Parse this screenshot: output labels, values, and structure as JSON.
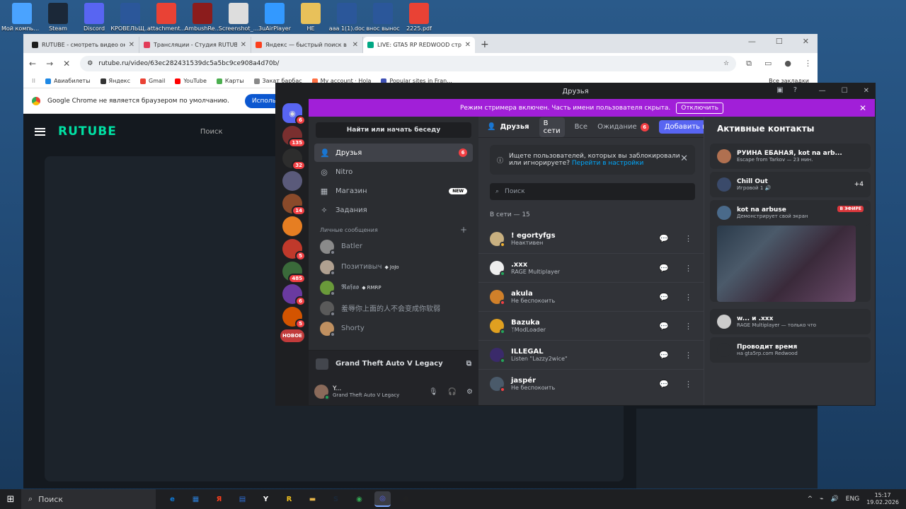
{
  "desktop": {
    "icons": [
      {
        "label": "Мой компьютер",
        "color": "#4aa3ff"
      },
      {
        "label": "Steam",
        "color": "#1b2838"
      },
      {
        "label": "Discord",
        "color": "#5865f2"
      },
      {
        "label": "КРОВЕЛЬЩ...",
        "color": "#2b579a"
      },
      {
        "label": "attachment...",
        "color": "#e94235"
      },
      {
        "label": "AmbushRe...",
        "color": "#8b1c1c"
      },
      {
        "label": "Screenshot_...",
        "color": "#dddddd"
      },
      {
        "label": "3uAirPlayer",
        "color": "#3399ff"
      },
      {
        "label": "НЕ",
        "color": "#e8c15a"
      },
      {
        "label": "ааа 1(1).doc",
        "color": "#2b579a"
      },
      {
        "label": "внос вынос",
        "color": "#2b579a"
      },
      {
        "label": "2225.pdf",
        "color": "#e94235"
      }
    ]
  },
  "chrome": {
    "tabs": [
      {
        "title": "RUTUBE - смотреть видео онлайн",
        "color": "#1d1d1d"
      },
      {
        "title": "Трансляции - Студия RUTUBE",
        "color": "#e23c58"
      },
      {
        "title": "Яндекс — быстрый поиск в интернете",
        "color": "#fc3f1d"
      },
      {
        "title": "LIVE: GTA5 RP REDWOOD стрим",
        "color": "#00a884"
      }
    ],
    "url": "rutube.ru/video/63ec282431539dc5a5bc9ce908a4d70b/",
    "bookmarks": [
      {
        "label": "Авиабилеты",
        "color": "#1e88e5"
      },
      {
        "label": "Яндекс",
        "color": "#333333"
      },
      {
        "label": "Gmail",
        "color": "#ea4335"
      },
      {
        "label": "YouTube",
        "color": "#ff0000"
      },
      {
        "label": "Карты",
        "color": "#4caf50"
      },
      {
        "label": "Закат барбас",
        "color": "#888888"
      },
      {
        "label": "My account · Hola",
        "color": "#ff7043"
      },
      {
        "label": "Popular sites in Fran...",
        "color": "#3f51b5"
      }
    ],
    "bookmarks_right": "Все закладки",
    "infobar_text": "Google Chrome не является браузером по умолчанию.",
    "infobar_button": "Использовать по ум",
    "rutube_logo": "RUTUBE",
    "rutube_search": "Поиск"
  },
  "discord": {
    "window_title": "Друзья",
    "streamer_bar_text": "Режим стримера включен. Часть имени пользователя скрыта.",
    "streamer_bar_button": "Отключить",
    "servers": [
      {
        "badge": "6",
        "color": "#5865f2",
        "home": true
      },
      {
        "badge": "135",
        "color": "#7a2f2f"
      },
      {
        "badge": "32",
        "color": "#2d2d2d"
      },
      {
        "badge": "",
        "color": "#5a5a7a"
      },
      {
        "badge": "14",
        "color": "#8a4a2a"
      },
      {
        "badge": "",
        "color": "#e67e22"
      },
      {
        "badge": "5",
        "color": "#c0392b"
      },
      {
        "badge": "485",
        "color": "#3a6a3a"
      },
      {
        "badge": "6",
        "color": "#6a3aa0"
      },
      {
        "badge": "5",
        "color": "#d35400"
      }
    ],
    "new_badge": "НОВОЕ",
    "dm_search": "Найти или начать беседу",
    "nav": [
      {
        "label": "Друзья",
        "icon": "👤",
        "count": "6",
        "new": ""
      },
      {
        "label": "Nitro",
        "icon": "◎",
        "count": "",
        "new": ""
      },
      {
        "label": "Магазин",
        "icon": "▦",
        "count": "",
        "new": "NEW"
      },
      {
        "label": "Задания",
        "icon": "✧",
        "count": "",
        "new": ""
      }
    ],
    "dm_header": "Личные сообщения",
    "dms": [
      {
        "name": "Batler",
        "tag": "",
        "color": "#8a8a8a",
        "status": "#80848e"
      },
      {
        "name": "Позитивыч",
        "tag": "JoJo",
        "color": "#b0a090",
        "status": "#80848e"
      },
      {
        "name": "𝕽𝖆𝖋𝖆𝖔",
        "tag": "RMRP",
        "color": "#6a9a3a",
        "status": "#80848e"
      },
      {
        "name": "羞辱你上面的人不会变成你软弱",
        "tag": "",
        "color": "#5a5a5a",
        "status": "#80848e"
      },
      {
        "name": "Shorty",
        "tag": "",
        "color": "#c09060",
        "status": "#80848e"
      }
    ],
    "activity_game": "Grand Theft Auto V Legacy",
    "user": {
      "name": "Y...",
      "status": "Grand Theft Auto V Legacy"
    },
    "friends_header": {
      "title": "Друзья",
      "tabs": [
        "В сети",
        "Все"
      ],
      "pending_label": "Ожидание",
      "pending_count": "6",
      "add_label": "Добавить в друзья"
    },
    "notice_text": "Ищете пользователей, которых вы заблокировали или игнорируете?",
    "notice_link": "Перейти в настройки",
    "search_placeholder": "Поиск",
    "online_label": "В сети — 15",
    "friends": [
      {
        "name": "! egortyfgs",
        "status": "Неактивен",
        "color": "#c8b080",
        "dot": "#f0b232"
      },
      {
        "name": ".xxx",
        "status": "RAGE Multiplayer",
        "color": "#eeeeee",
        "dot": "#23a55a"
      },
      {
        "name": "akula",
        "status": "Не беспокоить",
        "color": "#d0802a",
        "dot": "#f23f43"
      },
      {
        "name": "Bazuka",
        "status": "ᛉModLoader",
        "color": "#e0a020",
        "dot": "#23a55a"
      },
      {
        "name": "ILLEGAL",
        "status": "Listen \"Lazzy2wice\"",
        "color": "#3a2a6a",
        "dot": "#23a55a"
      },
      {
        "name": "jaspér",
        "status": "Не беспокоить",
        "color": "#4a5a6a",
        "dot": "#f23f43"
      }
    ],
    "active_title": "Активные контакты",
    "active": [
      {
        "name": "РУИНА ЕБАНАЯ, kot na arb...",
        "sub": "Escape from Tarkov — 23 мин.",
        "color": "#b07050",
        "extra": ""
      },
      {
        "name": "Chill Out",
        "sub": "Игровой 1 🔊",
        "color": "#3a4a6a",
        "extra": "+4"
      },
      {
        "name": "kot na arbuse",
        "sub": "Демонстрирует свой экран",
        "color": "#4a6a8a",
        "live": "В ЭФИРЕ"
      },
      {
        "name": "w... и .xxx",
        "sub": "RAGE Multiplayer — только что",
        "color": "#cccccc",
        "extra": ""
      },
      {
        "name": "Проводит время",
        "sub": "на gta5rp.com Redwood",
        "color": "#2b2d31",
        "extra": ""
      }
    ]
  },
  "taskbar": {
    "search": "Поиск",
    "apps": [
      {
        "label": "e",
        "color": "#0f7bd8"
      },
      {
        "label": "▦",
        "color": "#2b7cd3"
      },
      {
        "label": "Я",
        "color": "#fc3f1d"
      },
      {
        "label": "▤",
        "color": "#2f6fd6"
      },
      {
        "label": "Y",
        "color": "#ffffff"
      },
      {
        "label": "R",
        "color": "#f0c020"
      },
      {
        "label": "▬",
        "color": "#e8b64a"
      },
      {
        "label": "S",
        "color": "#1b2838"
      },
      {
        "label": "◉",
        "color": "#34a853"
      },
      {
        "label": "◎",
        "color": "#5865f2"
      },
      {
        "label": "◍",
        "color": "#222222"
      }
    ],
    "lang": "ENG",
    "time": "15:17",
    "date": "19.02.2026"
  }
}
